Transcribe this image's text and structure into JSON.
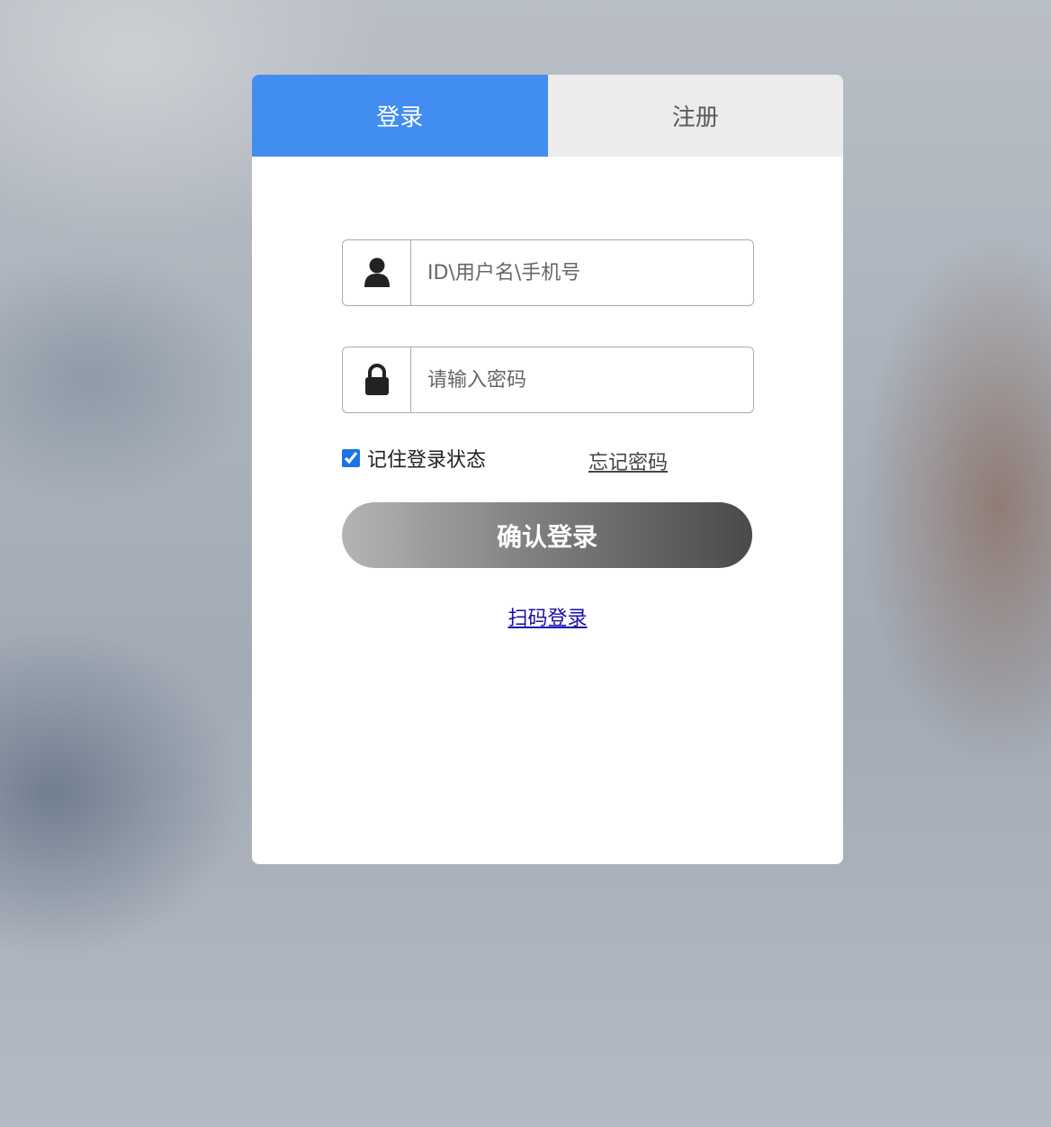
{
  "tabs": {
    "login_label": "登录",
    "register_label": "注册"
  },
  "form": {
    "username_placeholder": "ID\\用户名\\手机号",
    "username_value": "",
    "password_placeholder": "请输入密码",
    "password_value": "",
    "remember_label": "记住登录状态",
    "remember_checked": true,
    "forgot_label": "忘记密码",
    "submit_label": "确认登录",
    "qr_login_label": "扫码登录"
  },
  "icons": {
    "username": "user-icon",
    "password": "lock-icon"
  },
  "colors": {
    "active_tab": "#418df0",
    "inactive_tab": "#ececec",
    "link": "#1a0dab"
  }
}
